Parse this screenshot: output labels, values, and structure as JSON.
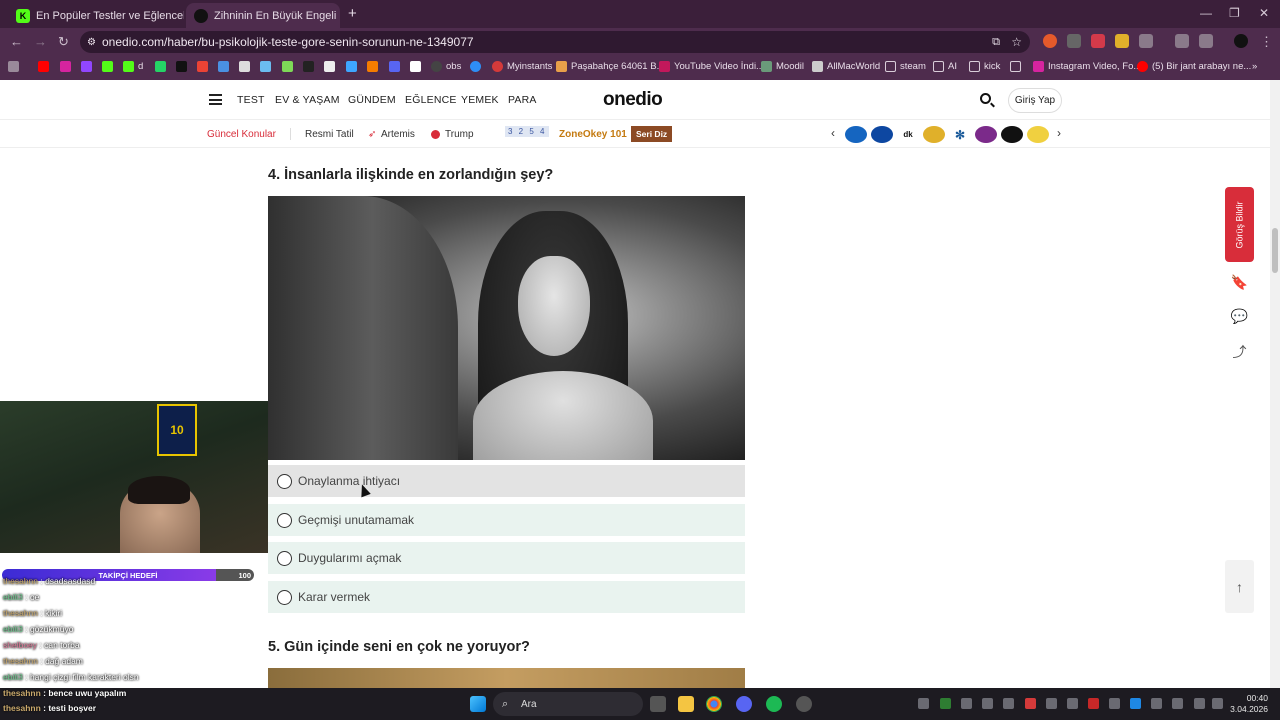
{
  "browser": {
    "tabs": [
      {
        "title": "En Popüler Testler ve Eğlenceli",
        "active": false
      },
      {
        "title": "Zihninin En Büyük Engeli Ne? -",
        "active": true
      }
    ],
    "new_tab": "+",
    "url": "onedio.com/haber/bu-psikolojik-teste-gore-senin-sorunun-ne-1349077",
    "bookmarks": [
      "d",
      "obs",
      "Myinstants",
      "Paşabahçe 64061 B...",
      "YouTube Video İndi...",
      "Moodil",
      "AllMacWorld",
      "steam",
      "AI",
      "kick",
      "Instagram Video, Fo...",
      "(5) Bir jant arabayı ne..."
    ]
  },
  "site": {
    "nav": [
      "TEST",
      "EV & YAŞAM",
      "GÜNDEM",
      "EĞLENCE",
      "YEMEK",
      "PARA"
    ],
    "logo": "onedio",
    "login": "Giriş Yap",
    "subnav": {
      "current": "Güncel Konular",
      "items": [
        "Resmi Tatil",
        "Artemis",
        "Trump"
      ],
      "zone_numbers": "3 2 5 4",
      "zone": "ZoneOkey 101",
      "seri_diz": "Seri Diz"
    }
  },
  "quiz": {
    "q4_title": "4. İnsanlarla ilişkinde en zorlandığın şey?",
    "options": [
      "Onaylanma ihtiyacı",
      "Geçmişi unutamamak",
      "Duygularımı açmak",
      "Karar vermek"
    ],
    "hovered_option": 0,
    "q5_title": "5. Gün içinde seni en çok ne yoruyor?"
  },
  "side": {
    "feedback": "Görüş Bildir"
  },
  "stream": {
    "jersey_number": "10",
    "goal_label": "TAKİPÇİ HEDEFİ",
    "goal_value": "100",
    "chat": [
      {
        "user": "thesahnn",
        "msg": "dsadsasdasd"
      },
      {
        "user": "ebili3",
        "msg": "oe"
      },
      {
        "user": "thesahnn",
        "msg": "kikiri"
      },
      {
        "user": "ebili3",
        "msg": "gözükmüyo"
      },
      {
        "user": "shelboey",
        "msg": "can torba"
      },
      {
        "user": "thesahnn",
        "msg": "dağ adam"
      },
      {
        "user": "ebili3",
        "msg": "hangi çizgi film karakteri olsn"
      },
      {
        "user": "thesahnn",
        "msg": "bence uwu yapalım"
      },
      {
        "user": "thesahnn",
        "msg": "testi boşver"
      }
    ]
  },
  "taskbar": {
    "search_placeholder": "Ara",
    "time": "00:40",
    "date": "3.04.2026"
  },
  "colors": {
    "accent_red": "#d82d3a",
    "option_bg": "#e9f3ef",
    "browser_bg": "#4e2c4d"
  }
}
